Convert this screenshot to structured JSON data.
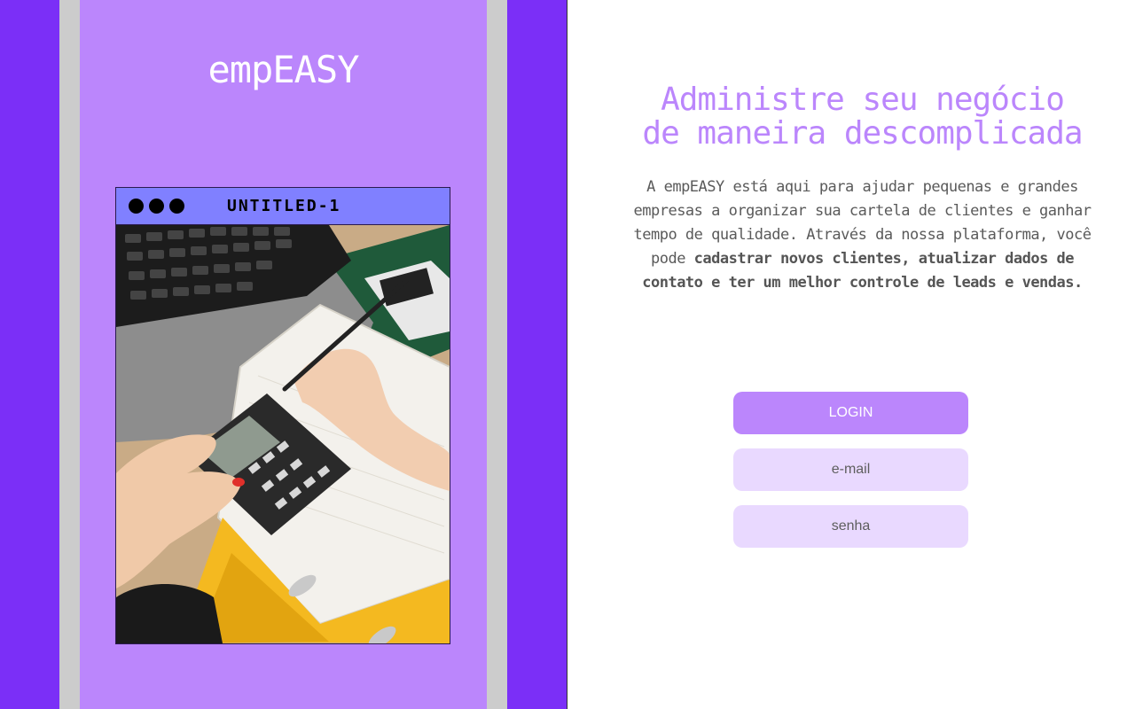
{
  "brand": {
    "name": "empEASY"
  },
  "window": {
    "title": "UNTITLED-1"
  },
  "hero": {
    "headline_line1": "Administre seu negócio",
    "headline_line2": "de maneira descomplicada",
    "description_plain": "A empEASY está aqui para ajudar pequenas e grandes empresas a organizar sua cartela de clientes e ganhar tempo de qualidade. Através da nossa plataforma, você pode ",
    "description_bold": "cadastrar  novos clientes, atualizar dados de contato e  ter um melhor controle de leads e vendas."
  },
  "form": {
    "login_label": "LOGIN",
    "email_placeholder": "e-mail",
    "password_placeholder": "senha"
  },
  "colors": {
    "purple_dark": "#7b2ff7",
    "purple_light": "#bb86fc",
    "window_bar": "#8080ff",
    "input_bg": "#e9d9ff",
    "strip_gray": "#cccccc"
  }
}
